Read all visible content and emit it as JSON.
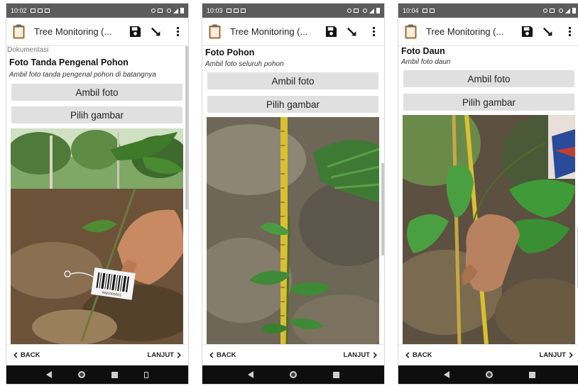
{
  "screens": [
    {
      "status_time": "10:02",
      "app_title": "Tree Monitoring (...",
      "section_label": "Dokumentasi",
      "question_title": "Foto Tanda Pengenal Pohon",
      "question_hint": "Ambil foto tanda pengenal pohon di batangnya",
      "take_photo_label": "Ambil foto",
      "choose_image_label": "Pilih gambar",
      "back_label": "BACK",
      "next_label": "LANJUT",
      "barcode_text": "RM1000001"
    },
    {
      "status_time": "10:03",
      "app_title": "Tree Monitoring (...",
      "question_title": "Foto Pohon",
      "question_hint": "Ambil foto seluruh pohon",
      "take_photo_label": "Ambil foto",
      "choose_image_label": "Pilih gambar",
      "back_label": "BACK",
      "next_label": "LANJUT"
    },
    {
      "status_time": "10:04",
      "app_title": "Tree Monitoring (...",
      "question_title": "Foto Daun",
      "question_hint": "Ambil foto daun",
      "take_photo_label": "Ambil foto",
      "choose_image_label": "Pilih gambar",
      "back_label": "BACK",
      "next_label": "LANJUT"
    }
  ],
  "icons": {
    "app": "clipboard-icon",
    "save": "save-icon",
    "jump": "jump-arrow-icon",
    "overflow": "more-vert-icon",
    "back": "chevron-left-icon",
    "next": "chevron-right-icon"
  },
  "colors": {
    "status_bar": "#5c5c5c",
    "button_bg": "#e0e0e0",
    "system_nav": "#0e0e0e",
    "clipboard_brown": "#a56a2a"
  }
}
